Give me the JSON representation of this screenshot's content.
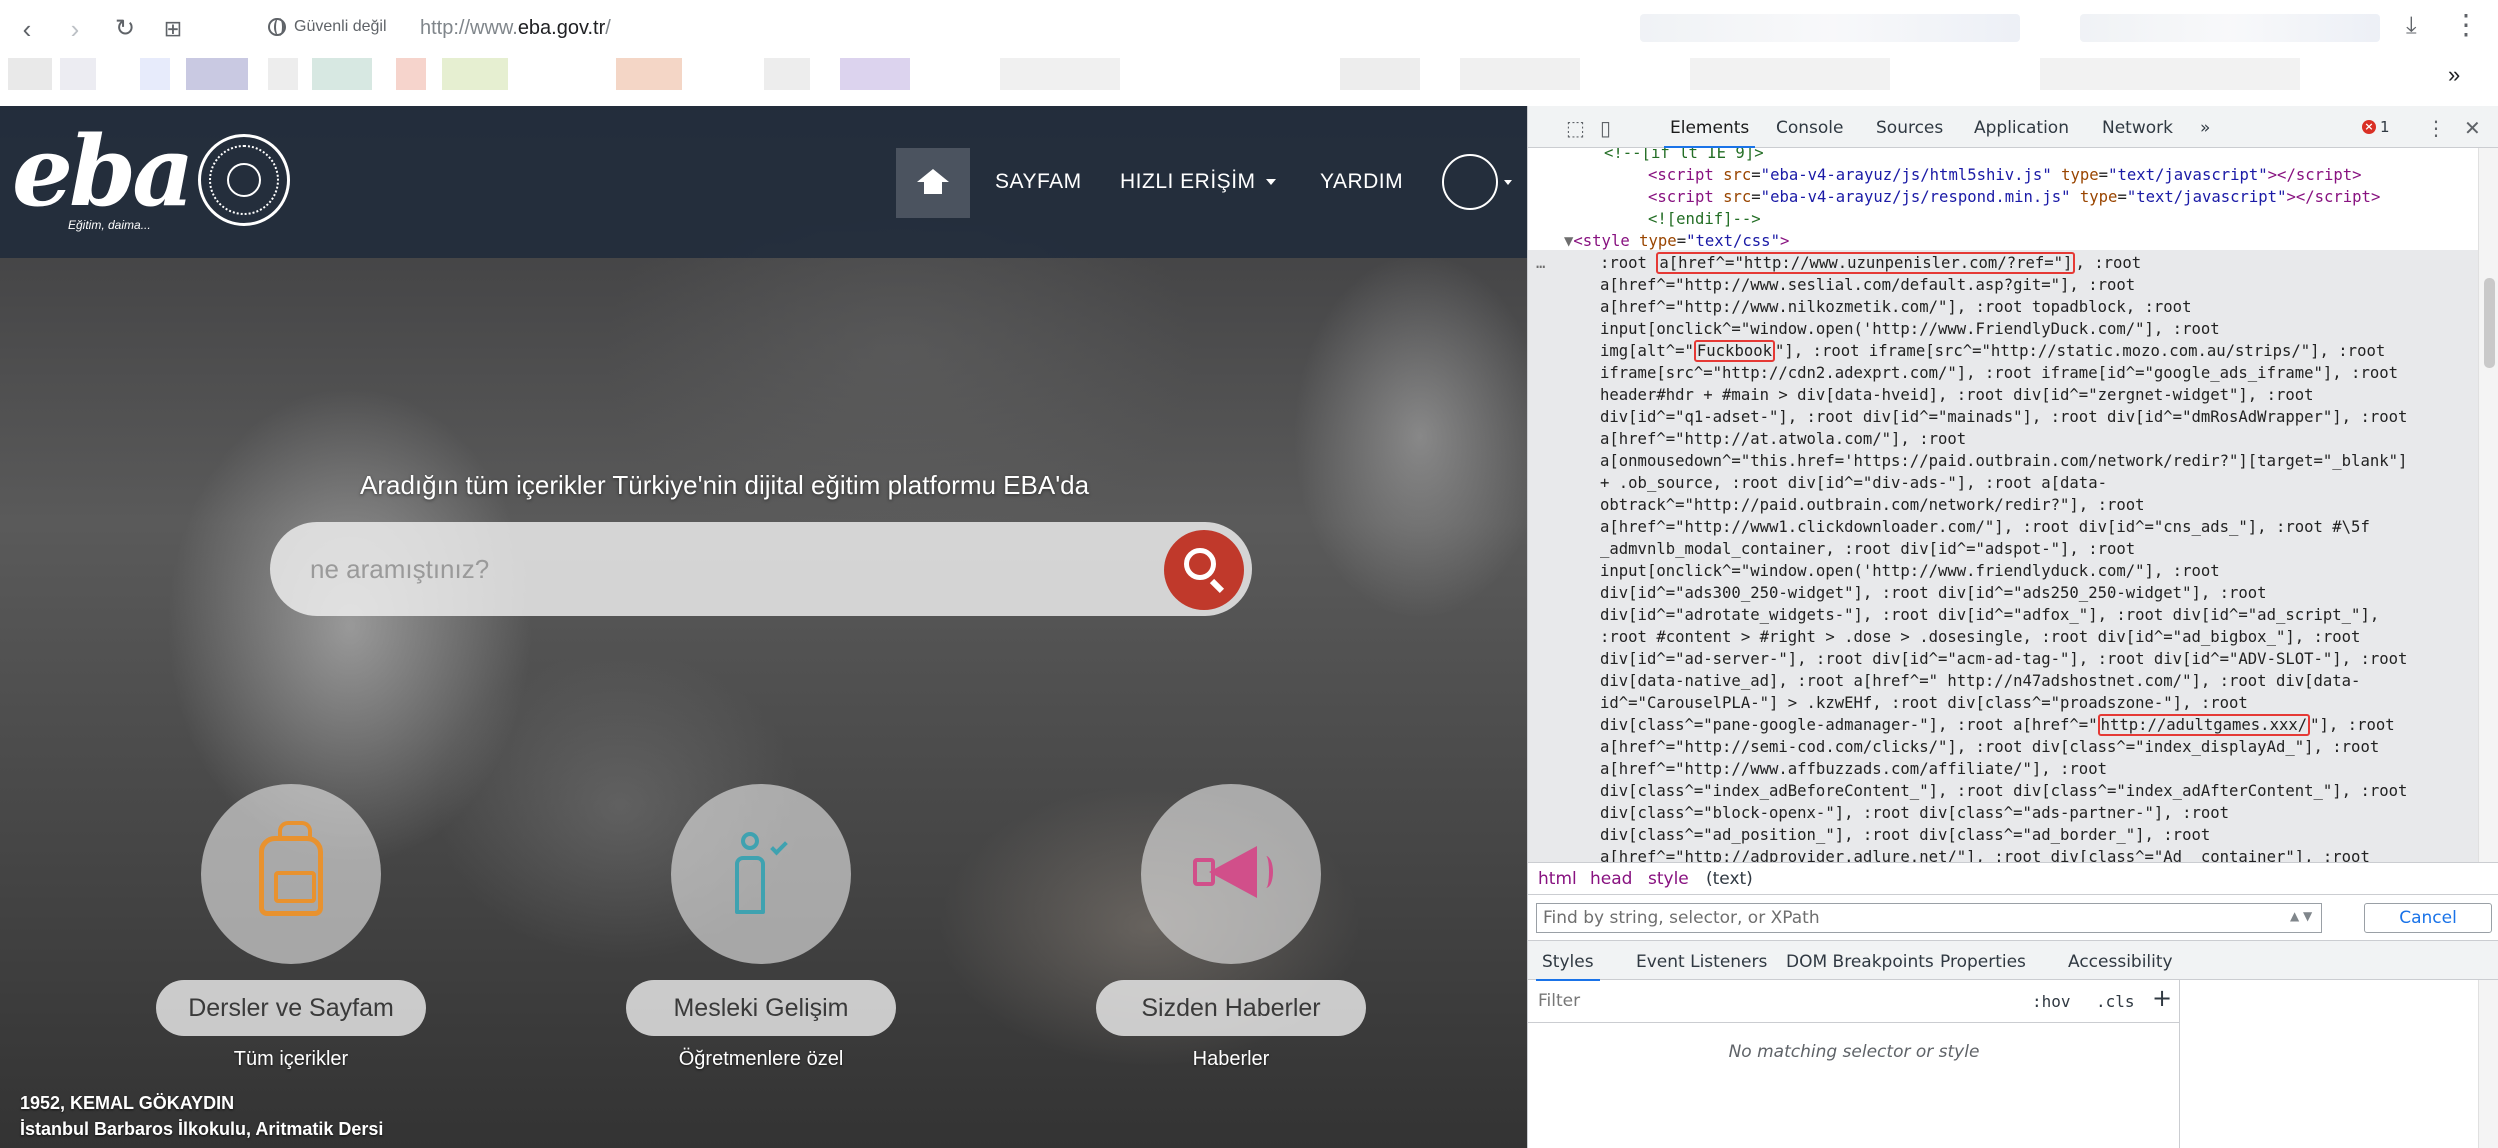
{
  "browser": {
    "security_label": "Güvenli değil",
    "url_scheme": "http://www.",
    "url_host": "eba.gov.tr",
    "url_path": "/"
  },
  "eba": {
    "logo": "eba",
    "tagline": "Eğitim, daima...",
    "nav": {
      "sayfam": "SAYFAM",
      "hizli_erisim": "HIZLI ERİŞİM",
      "yardim": "YARDIM"
    },
    "hero_title": "Aradığın tüm içerikler Türkiye'nin dijital eğitim platformu EBA'da",
    "search_placeholder": "ne aramıştınız?",
    "features": [
      {
        "label": "Dersler ve Sayfam",
        "sub": "Tüm içerikler"
      },
      {
        "label": "Mesleki Gelişim",
        "sub": "Öğretmenlere özel"
      },
      {
        "label": "Sizden Haberler",
        "sub": "Haberler"
      }
    ],
    "caption": {
      "line1": "1952, KEMAL GÖKAYDIN",
      "line2": "İstanbul Barbaros İlkokulu, Aritmatik Dersi"
    }
  },
  "devtools": {
    "tabs": [
      "Elements",
      "Console",
      "Sources",
      "Application",
      "Network"
    ],
    "more_tabs": "»",
    "error_count": "1",
    "code": {
      "l0": "<!--[if lt IE 9]>",
      "s1_src": "eba-v4-arayuz/js/html5shiv.js",
      "s2_src": "eba-v4-arayuz/js/respond.min.js",
      "type_js": "text/javascript",
      "endif": "<![endif]-->",
      "style_type": "text/css",
      "css_lines": [
        [
          ":root ",
          "a[href^=\"http://www.uzunpenisler.com/?ref=\"]",
          ", :root"
        ],
        [
          "a[href^=\"http://www.seslial.com/default.asp?git=\"], :root"
        ],
        [
          "a[href^=\"http://www.nilkozmetik.com/\"], :root topadblock, :root"
        ],
        [
          "input[onclick^=\"window.open('http://www.FriendlyDuck.com/\"], :root"
        ],
        [
          "img[alt^=\"",
          "Fuckbook",
          "\"], :root iframe[src^=\"http://static.mozo.com.au/strips/\"], :root"
        ],
        [
          "iframe[src^=\"http://cdn2.adexprt.com/\"], :root iframe[id^=\"google_ads_iframe\"], :root"
        ],
        [
          "header#hdr + #main > div[data-hveid], :root div[id^=\"zergnet-widget\"], :root"
        ],
        [
          "div[id^=\"q1-adset-\"], :root div[id^=\"mainads\"], :root div[id^=\"dmRosAdWrapper\"], :root"
        ],
        [
          "a[href^=\"http://at.atwola.com/\"], :root"
        ],
        [
          "a[onmousedown^=\"this.href='https://paid.outbrain.com/network/redir?\"][target=\"_blank\"]"
        ],
        [
          "+ .ob_source, :root div[id^=\"div-ads-\"], :root a[data-"
        ],
        [
          "obtrack^=\"http://paid.outbrain.com/network/redir?\"], :root"
        ],
        [
          "a[href^=\"http://www1.clickdownloader.com/\"], :root div[id^=\"cns_ads_\"], :root #\\5f"
        ],
        [
          "_admvnlb_modal_container, :root div[id^=\"adspot-\"], :root"
        ],
        [
          "input[onclick^=\"window.open('http://www.friendlyduck.com/\"], :root"
        ],
        [
          "div[id^=\"ads300_250-widget\"], :root div[id^=\"ads250_250-widget\"], :root"
        ],
        [
          "div[id^=\"adrotate_widgets-\"], :root div[id^=\"adfox_\"], :root div[id^=\"ad_script_\"],"
        ],
        [
          ":root #content > #right > .dose > .dosesingle, :root div[id^=\"ad_bigbox_\"], :root"
        ],
        [
          "div[id^=\"ad-server-\"], :root div[id^=\"acm-ad-tag-\"], :root div[id^=\"ADV-SLOT-\"], :root"
        ],
        [
          "div[data-native_ad], :root a[href^=\" http://n47adshostnet.com/\"], :root div[data-"
        ],
        [
          "id^=\"CarouselPLA-\"] > .kzwEHf, :root div[class^=\"proadszone-\"], :root"
        ],
        [
          "div[class^=\"pane-google-admanager-\"], :root a[href^=\"",
          "http://adultgames.xxx/",
          "\"], :root"
        ],
        [
          "a[href^=\"http://semi-cod.com/clicks/\"], :root div[class^=\"index_displayAd_\"], :root"
        ],
        [
          "a[href^=\"http://www.affbuzzads.com/affiliate/\"], :root"
        ],
        [
          "div[class^=\"index_adBeforeContent_\"], :root div[class^=\"index_adAfterContent_\"], :root"
        ],
        [
          "div[class^=\"block-openx-\"], :root div[class^=\"ads-partner-\"], :root"
        ],
        [
          "div[class^=\"ad_position_\"], :root div[class^=\"ad_border_\"], :root"
        ],
        [
          "a[href^=\"http://adprovider.adlure.net/\"], :root div[class^=\"Ad__container\"], :root"
        ]
      ]
    },
    "breadcrumbs": [
      "html",
      "head",
      "style",
      "(text)"
    ],
    "find_placeholder": "Find by string, selector, or XPath",
    "cancel_label": "Cancel",
    "sub_tabs": [
      "Styles",
      "Event Listeners",
      "DOM Breakpoints",
      "Properties",
      "Accessibility"
    ],
    "filter_placeholder": "Filter",
    "hov": ":hov",
    "cls": ".cls",
    "plus": "+",
    "no_match": "No matching selector or style"
  }
}
